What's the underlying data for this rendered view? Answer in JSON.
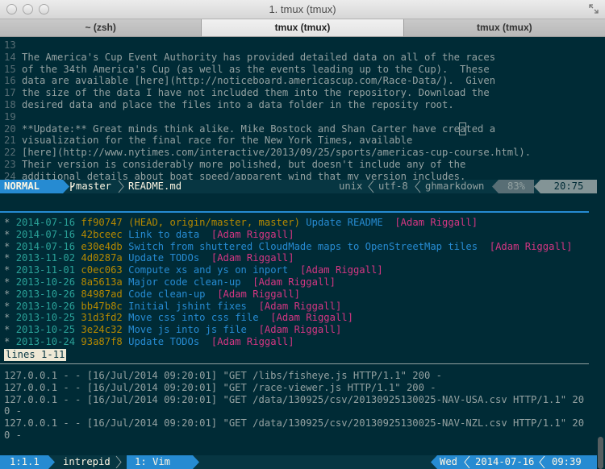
{
  "window": {
    "title": "1. tmux (tmux)"
  },
  "tabs": [
    {
      "label": "~ (zsh)"
    },
    {
      "label": "tmux (tmux)"
    },
    {
      "label": "tmux (tmux)"
    }
  ],
  "editor": {
    "lines": [
      {
        "n": "13",
        "text": ""
      },
      {
        "n": "14",
        "text": "The America's Cup Event Authority has provided detailed data on all of the races"
      },
      {
        "n": "15",
        "text": "of the 34th America's Cup (as well as the events leading up to the Cup).  These"
      },
      {
        "n": "16",
        "text": "data are available [here](http://noticeboard.americascup.com/Race-Data/).  Given"
      },
      {
        "n": "17",
        "text": "the size of the data I have not included them into the repository. Download the"
      },
      {
        "n": "18",
        "text": "desired data and place the files into a data folder in the reposity root."
      },
      {
        "n": "19",
        "text": ""
      },
      {
        "n": "20",
        "text_a": "**Update:** Great minds think alike. Mike Bostock and Shan Carter have cre",
        "cursor": "a",
        "text_b": "ted a"
      },
      {
        "n": "21",
        "text": "visualization for the final race for the New York Times, available"
      },
      {
        "n": "22",
        "text": "[here](http://www.nytimes.com/interactive/2013/09/25/sports/americas-cup-course.html)."
      },
      {
        "n": "23",
        "text": "Their version is considerably more polished, but doesn't include any of the"
      },
      {
        "n": "24",
        "text": "additional details about boat speed/apparent wind that my version includes."
      }
    ],
    "status": {
      "mode": "NORMAL",
      "branch_icon": "branch-icon",
      "branch": "master",
      "file": "README.md",
      "format": "unix",
      "encoding": "utf-8",
      "filetype": "ghmarkdown",
      "percent": "83%",
      "position": "20:75"
    }
  },
  "gitlog": {
    "commits": [
      {
        "date": "2014-07-16",
        "hash": "ff90747",
        "refs": "(HEAD, origin/master, master)",
        "message": "Update README",
        "author": "[Adam Riggall]"
      },
      {
        "date": "2014-07-16",
        "hash": "42bceec",
        "refs": "",
        "message": "Link to data",
        "author": "[Adam Riggall]"
      },
      {
        "date": "2014-07-16",
        "hash": "e30e4db",
        "refs": "",
        "message": "Switch from shuttered CloudMade maps to OpenStreetMap tiles",
        "author": "[Adam Riggall]"
      },
      {
        "date": "2013-11-02",
        "hash": "4d0287a",
        "refs": "",
        "message": "Update TODOs",
        "author": "[Adam Riggall]"
      },
      {
        "date": "2013-11-01",
        "hash": "c0ec063",
        "refs": "",
        "message": "Compute xs and ys on inport",
        "author": "[Adam Riggall]"
      },
      {
        "date": "2013-10-26",
        "hash": "8a5613a",
        "refs": "",
        "message": "Major code clean-up",
        "author": "[Adam Riggall]"
      },
      {
        "date": "2013-10-26",
        "hash": "84987ad",
        "refs": "",
        "message": "Code clean-up",
        "author": "[Adam Riggall]"
      },
      {
        "date": "2013-10-26",
        "hash": "bb47b8c",
        "refs": "",
        "message": "Initial jshint fixes",
        "author": "[Adam Riggall]"
      },
      {
        "date": "2013-10-25",
        "hash": "31d3fd2",
        "refs": "",
        "message": "Move css into css file",
        "author": "[Adam Riggall]"
      },
      {
        "date": "2013-10-25",
        "hash": "3e24c32",
        "refs": "",
        "message": "Move js into js file",
        "author": "[Adam Riggall]"
      },
      {
        "date": "2013-10-24",
        "hash": "93a87f8",
        "refs": "",
        "message": "Update TODOs",
        "author": "[Adam Riggall]"
      }
    ],
    "pager_status": "lines 1-11"
  },
  "server_log": {
    "lines": [
      "127.0.0.1 - - [16/Jul/2014 09:20:01] \"GET /libs/fisheye.js HTTP/1.1\" 200 -",
      "127.0.0.1 - - [16/Jul/2014 09:20:01] \"GET /race-viewer.js HTTP/1.1\" 200 -",
      "127.0.0.1 - - [16/Jul/2014 09:20:01] \"GET /data/130925/csv/20130925130025-NAV-USA.csv HTTP/1.1\" 20",
      "0 -",
      "127.0.0.1 - - [16/Jul/2014 09:20:01] \"GET /data/130925/csv/20130925130025-NAV-NZL.csv HTTP/1.1\" 20",
      "0 -"
    ]
  },
  "tmux_status": {
    "session": "1:1.1",
    "host": "intrepid",
    "window": "1: Vim",
    "day": "Wed",
    "date": "2014-07-16",
    "time": "09:39"
  },
  "colors": {
    "background": "#002b36",
    "statusbar": "#073642",
    "blue": "#268bd2",
    "yellow": "#b58900",
    "cyan": "#2aa198",
    "magenta": "#d33682",
    "text": "#93a1a1"
  }
}
